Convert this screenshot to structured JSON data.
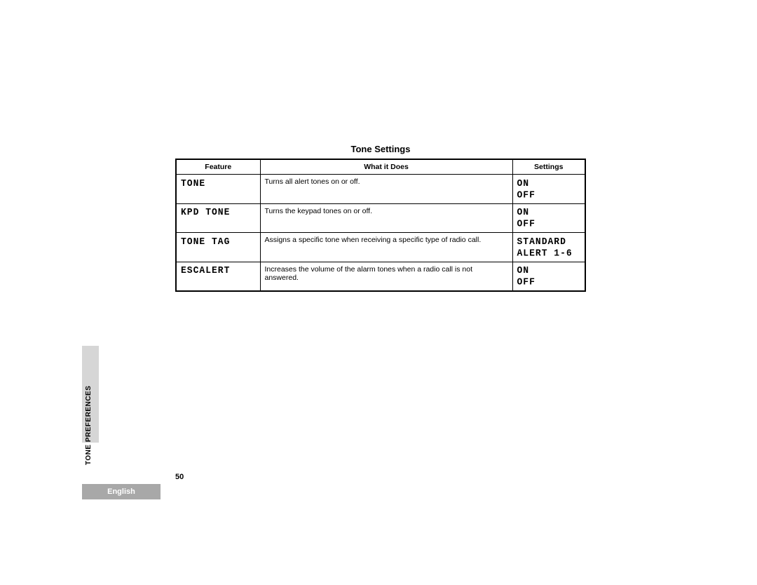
{
  "title": "Tone Settings",
  "headers": {
    "feature": "Feature",
    "does": "What it Does",
    "settings": "Settings"
  },
  "rows": [
    {
      "feature": "TONE",
      "does": "Turns all alert tones on or off.",
      "settings": "ON\nOFF"
    },
    {
      "feature": "KPD TONE",
      "does": "Turns the keypad tones on or off.",
      "settings": "ON\nOFF"
    },
    {
      "feature": "TONE TAG",
      "does": "Assigns a specific tone when receiving a specific type of radio call.",
      "settings": "STANDARD\nALERT 1-6"
    },
    {
      "feature": "ESCALERT",
      "does": "Increases the volume of the alarm tones when a radio call is not answered.",
      "settings": "ON\nOFF"
    }
  ],
  "side_tab": "TONE PREFERENCES",
  "page_number": "50",
  "language": "English"
}
